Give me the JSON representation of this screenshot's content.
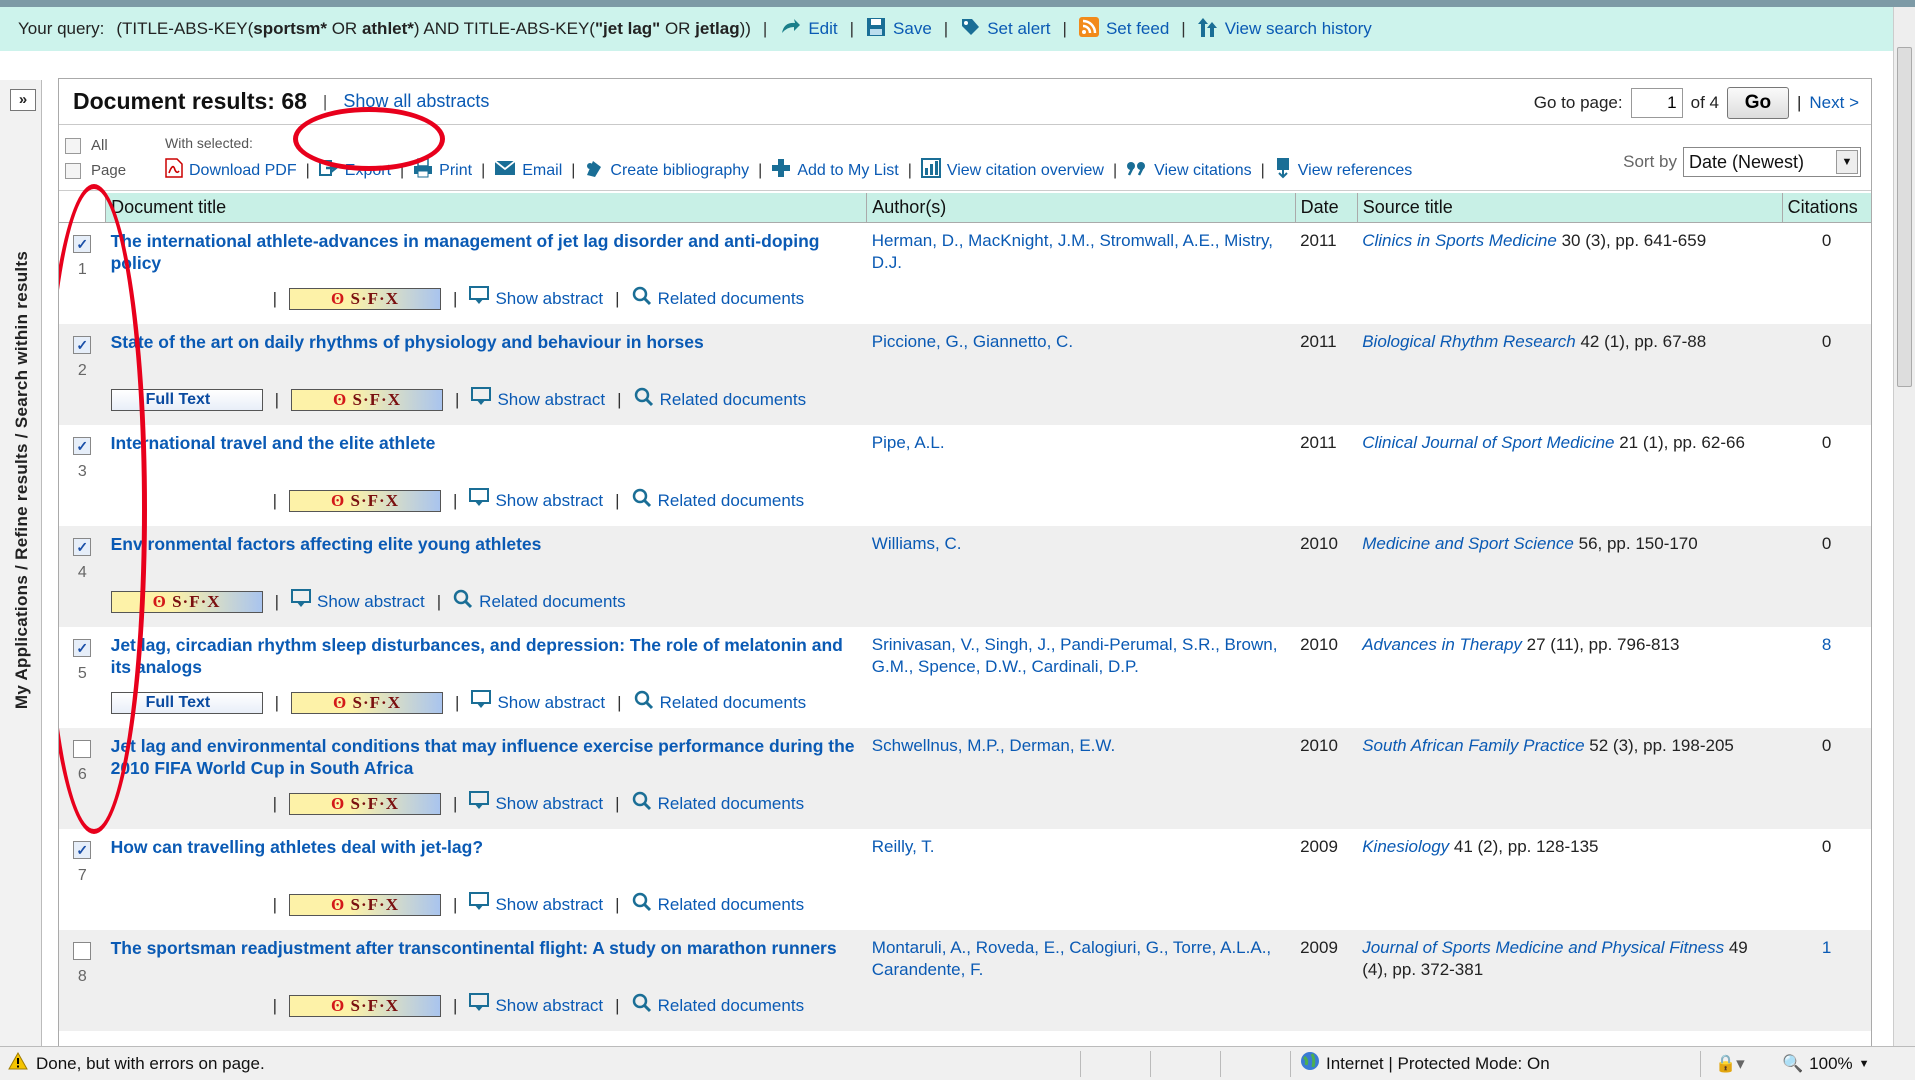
{
  "query": {
    "label": "Your query:",
    "text_prefix": "(TITLE-ABS-KEY(",
    "t1": "sportsm*",
    "t2": " OR ",
    "t3": "athlet*",
    "t4": ") AND TITLE-ABS-KEY(",
    "t5": "\"jet lag\"",
    "t6": " OR ",
    "t7": "jetlag",
    "t8": "))",
    "actions": [
      "Edit",
      "Save",
      "Set alert",
      "Set feed",
      "View search history"
    ]
  },
  "sidebar": {
    "expand": "»",
    "label": "My Applications / Refine results / Search within results"
  },
  "results_header": {
    "title": "Document results: 68",
    "show_all": "Show all abstracts",
    "goto_label": "Go to page:",
    "page_value": "1",
    "of_pages": "of 4",
    "go": "Go",
    "next": "Next >"
  },
  "toolbar": {
    "all": "All",
    "page": "Page",
    "with_selected": "With selected:",
    "actions": [
      "Download PDF",
      "Export",
      "Print",
      "Email",
      "Create bibliography",
      "Add to My List",
      "View citation overview",
      "View citations",
      "View references"
    ],
    "sort_label": "Sort by",
    "sort_value": "Date (Newest)"
  },
  "columns": [
    "Document title",
    "Author(s)",
    "Date",
    "Source title",
    "Citations"
  ],
  "results": [
    {
      "num": "1",
      "checked": true,
      "title": "The international athlete-advances in management of jet lag disorder and anti-doping policy",
      "authors": "Herman, D., MacKnight, J.M., Stromwall, A.E., Mistry, D.J.",
      "date": "2011",
      "source": "Clinics in Sports Medicine",
      "source_detail": " 30 (3), pp. 641-659",
      "citations": "0",
      "full_text": false,
      "lead_sep": true
    },
    {
      "num": "2",
      "checked": true,
      "title": "State of the art on daily rhythms of physiology and behaviour in horses",
      "authors": "Piccione, G., Giannetto, C.",
      "date": "2011",
      "source": "Biological Rhythm Research",
      "source_detail": " 42 (1), pp. 67-88",
      "citations": "0",
      "full_text": true,
      "lead_sep": false
    },
    {
      "num": "3",
      "checked": true,
      "title": "International travel and the elite athlete",
      "authors": "Pipe, A.L.",
      "date": "2011",
      "source": "Clinical Journal of Sport Medicine",
      "source_detail": " 21 (1), pp. 62-66",
      "citations": "0",
      "full_text": false,
      "lead_sep": true
    },
    {
      "num": "4",
      "checked": true,
      "title": "Environmental factors affecting elite young athletes",
      "authors": "Williams, C.",
      "date": "2010",
      "source": "Medicine and Sport Science",
      "source_detail": " 56, pp. 150-170",
      "citations": "0",
      "full_text": false,
      "lead_sep": false
    },
    {
      "num": "5",
      "checked": true,
      "title": "Jet lag, circadian rhythm sleep disturbances, and depression: The role of melatonin and its analogs",
      "authors": "Srinivasan, V., Singh, J., Pandi-Perumal, S.R., Brown, G.M., Spence, D.W., Cardinali, D.P.",
      "date": "2010",
      "source": "Advances in Therapy",
      "source_detail": " 27 (11), pp. 796-813",
      "citations": "8",
      "full_text": true,
      "lead_sep": false
    },
    {
      "num": "6",
      "checked": false,
      "title": "Jet lag and environmental conditions that may influence exercise performance during the 2010 FIFA World Cup in South Africa",
      "authors": "Schwellnus, M.P., Derman, E.W.",
      "date": "2010",
      "source": "South African Family Practice",
      "source_detail": " 52 (3), pp. 198-205",
      "citations": "0",
      "full_text": false,
      "lead_sep": true
    },
    {
      "num": "7",
      "checked": true,
      "title": "How can travelling athletes deal with jet-lag?",
      "authors": "Reilly, T.",
      "date": "2009",
      "source": "Kinesiology",
      "source_detail": " 41 (2), pp. 128-135",
      "citations": "0",
      "full_text": false,
      "lead_sep": true
    },
    {
      "num": "8",
      "checked": false,
      "title": "The sportsman readjustment after transcontinental flight: A study on marathon runners",
      "authors": "Montaruli, A., Roveda, E., Calogiuri, G., Torre, A.L.A., Carandente, F.",
      "date": "2009",
      "source": "Journal of Sports Medicine and Physical Fitness",
      "source_detail": " 49 (4), pp. 372-381",
      "citations": "1",
      "full_text": false,
      "lead_sep": true
    }
  ],
  "row_links": {
    "full_text": "Full Text",
    "sfx": "S·F·X",
    "show_abstract": "Show abstract",
    "related": "Related documents"
  },
  "status": {
    "message": "Done, but with errors on page.",
    "zone": "Internet | Protected Mode: On",
    "zoom": "100%"
  },
  "colors": {
    "link": "#0a5ab4",
    "header_bg": "#c8f0e6",
    "query_bg": "#cdf3ec",
    "annotation": "#e8001c"
  }
}
